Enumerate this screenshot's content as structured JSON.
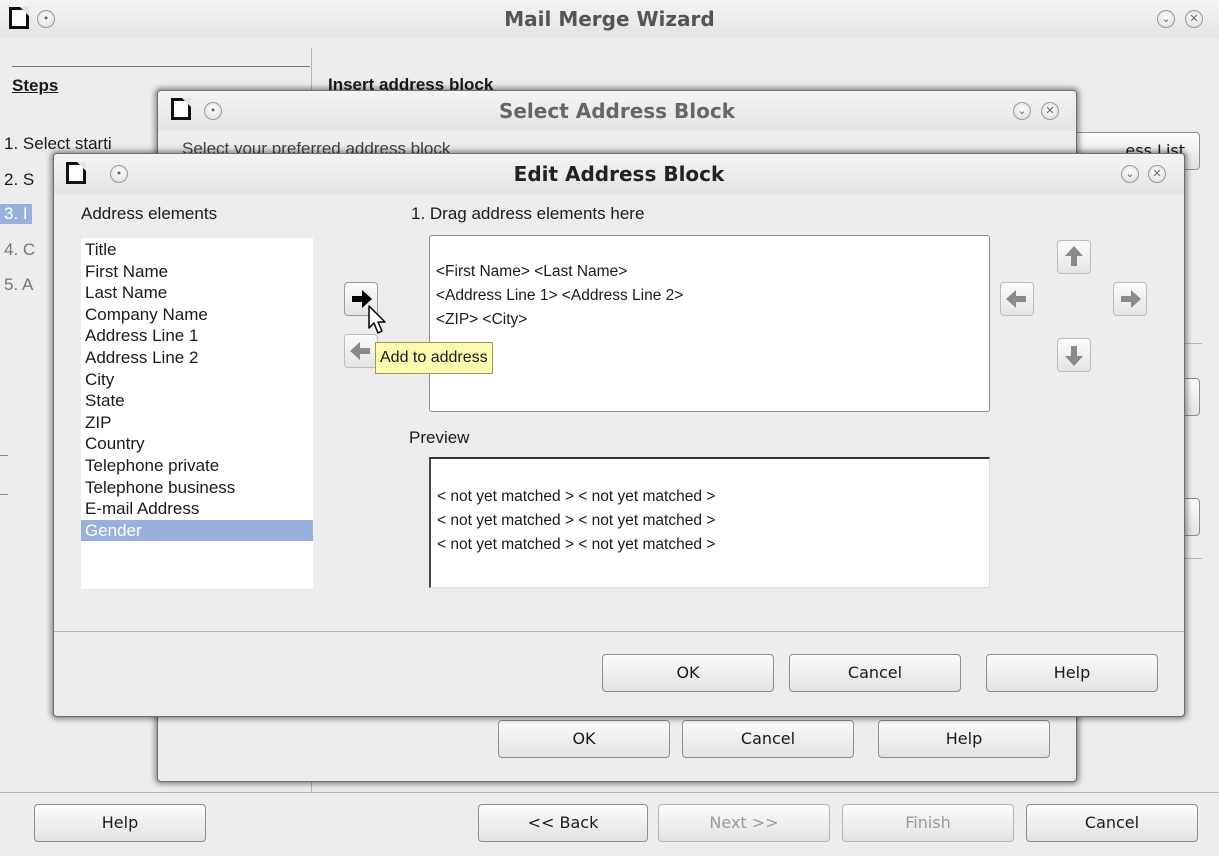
{
  "main_window": {
    "title": "Mail Merge Wizard",
    "steps_heading": "Steps",
    "steps": [
      "1. Select starti",
      "2. S",
      "3. I",
      "4. C",
      "5. A"
    ],
    "page_heading": "Insert address block",
    "bg_button_label": "ess List",
    "buttons": {
      "help": "Help",
      "back": "<< Back",
      "next": "Next >>",
      "finish": "Finish",
      "cancel": "Cancel"
    }
  },
  "select_dialog": {
    "title": "Select Address Block",
    "instruction": "Select your preferred address block",
    "buttons": {
      "ok": "OK",
      "cancel": "Cancel",
      "help": "Help"
    }
  },
  "edit_dialog": {
    "title": "Edit Address Block",
    "elements_label": "Address elements",
    "elements": [
      "Title",
      "First Name",
      "Last Name",
      "Company Name",
      "Address Line 1",
      "Address Line 2",
      "City",
      "State",
      "ZIP",
      "Country",
      "Telephone private",
      "Telephone business",
      "E-mail Address",
      "Gender"
    ],
    "selected_element": "Gender",
    "drag_label": "1. Drag address elements here",
    "address_lines": [
      "<First Name> <Last Name>",
      "<Address Line 1> <Address Line 2>",
      "<ZIP> <City>"
    ],
    "preview_label": "Preview",
    "preview_lines": [
      "< not yet matched > < not yet matched >",
      "< not yet matched > < not yet matched >",
      "< not yet matched > < not yet matched >"
    ],
    "tooltip": "Add to address",
    "buttons": {
      "ok": "OK",
      "cancel": "Cancel",
      "help": "Help"
    }
  },
  "colors": {
    "selection": "#97b1da",
    "tooltip_bg": "#fbfbaf",
    "arrow_disabled": "#8a8a8a"
  }
}
